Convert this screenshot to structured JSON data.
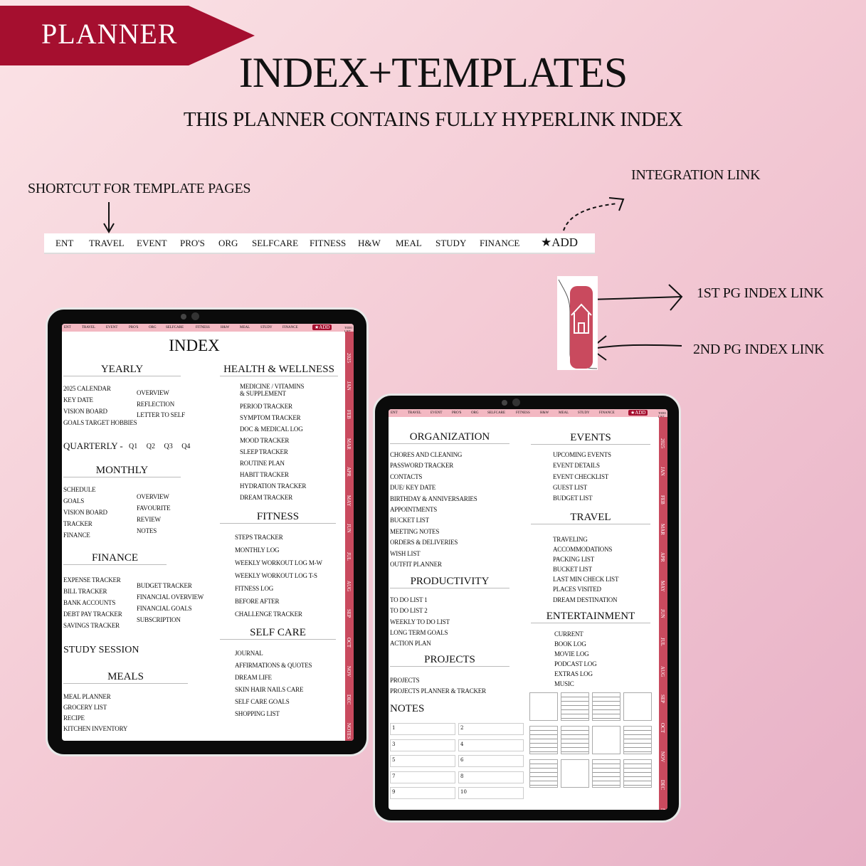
{
  "banner": "PLANNER",
  "title": "INDEX+TEMPLATES",
  "subtitle": "THIS PLANNER CONTAINS FULLY HYPERLINK INDEX",
  "annotations": {
    "shortcut": "SHORTCUT FOR TEMPLATE PAGES",
    "integration": "INTEGRATION LINK",
    "first_pg": "1ST PG INDEX LINK",
    "second_pg": "2ND PG INDEX LINK"
  },
  "tabs": [
    "ENT",
    "TRAVEL",
    "EVENT",
    "PRO'S",
    "ORG",
    "SELFCARE",
    "FITNESS",
    "H&W",
    "MEAL",
    "STUDY",
    "FINANCE"
  ],
  "add_label": "★ADD",
  "todo_label": "TODO LIST",
  "months": [
    "2025",
    "JAN",
    "FEB",
    "MAR",
    "APR",
    "MAY",
    "JUN",
    "JUL",
    "AUG",
    "SEP",
    "OCT",
    "NOV",
    "DEC",
    "NOTES"
  ],
  "colors": {
    "accent": "#a50f2f",
    "tab_pink": "#f3b8c2",
    "side_tab": "#c94a5e"
  },
  "page1": {
    "title": "INDEX",
    "yearly": {
      "heading": "YEARLY",
      "left": [
        "2025 CALENDAR",
        "KEY DATE",
        "VISION BOARD",
        "GOALS TARGET HOBBIES"
      ],
      "right": [
        "OVERVIEW",
        "REFLECTION",
        "LETTER TO SELF"
      ]
    },
    "quarterly": {
      "label": "QUARTERLY -",
      "items": [
        "Q1",
        "Q2",
        "Q3",
        "Q4"
      ]
    },
    "monthly": {
      "heading": "MONTHLY",
      "left": [
        "SCHEDULE",
        "GOALS",
        "VISION BOARD",
        "TRACKER",
        "FINANCE"
      ],
      "right": [
        "OVERVIEW",
        "FAVOURITE",
        "REVIEW",
        "NOTES"
      ]
    },
    "finance": {
      "heading": "FINANCE",
      "left": [
        "EXPENSE TRACKER",
        "BILL TRACKER",
        "BANK ACCOUNTS",
        "DEBT PAY TRACKER",
        "SAVINGS TRACKER"
      ],
      "right": [
        "BUDGET TRACKER",
        "FINANCIAL OVERVIEW",
        "FINANCIAL GOALS",
        "SUBSCRIPTION"
      ]
    },
    "study": "STUDY SESSION",
    "meals": {
      "heading": "MEALS",
      "items": [
        "MEAL PLANNER",
        "GROCERY LIST",
        "RECIPE",
        "KITCHEN INVENTORY"
      ]
    },
    "health": {
      "heading": "HEALTH  & WELLNESS",
      "items": [
        "MEDICINE / VITAMINS",
        "& SUPPLEMENT",
        "PERIOD TRACKER",
        "SYMPTOM TRACKER",
        "DOC & MEDICAL LOG",
        "MOOD TRACKER",
        "SLEEP TRACKER",
        "ROUTINE PLAN",
        "HABIT TRACKER",
        "HYDRATION TRACKER",
        "DREAM TRACKER"
      ]
    },
    "fitness": {
      "heading": "FITNESS",
      "items": [
        "STEPS TRACKER",
        "MONTHLY LOG",
        "WEEKLY WORKOUT LOG  M-W",
        "WEEKLY WORKOUT LOG T-S",
        "FITNESS LOG",
        "BEFORE AFTER",
        "CHALLENGE TRACKER"
      ]
    },
    "selfcare": {
      "heading": "SELF CARE",
      "items": [
        "JOURNAL",
        "AFFIRMATIONS & QUOTES",
        "DREAM LIFE",
        "SKIN HAIR NAILS CARE",
        "SELF CARE GOALS",
        "SHOPPING LIST"
      ]
    }
  },
  "page2": {
    "organization": {
      "heading": "ORGANIZATION",
      "items": [
        "CHORES AND CLEANING",
        "PASSWORD TRACKER",
        "CONTACTS",
        "DUE/ KEY DATE",
        "BIRTHDAY & ANNIVERSARIES",
        "APPOINTMENTS",
        "BUCKET LIST",
        "MEETING NOTES",
        "ORDERS & DELIVERIES",
        "WISH LIST",
        "OUTFIT PLANNER"
      ]
    },
    "productivity": {
      "heading": "PRODUCTIVITY",
      "items": [
        "TO DO LIST 1",
        "TO DO LIST 2",
        "WEEKLY TO DO LIST",
        "LONG TERM GOALS",
        "ACTION PLAN"
      ]
    },
    "projects": {
      "heading": "PROJECTS",
      "items": [
        "PROJECTS",
        "PROJECTS PLANNER & TRACKER"
      ]
    },
    "notes": {
      "heading": "NOTES",
      "numbers": [
        "1",
        "2",
        "3",
        "4",
        "5",
        "6",
        "7",
        "8",
        "9",
        "10"
      ]
    },
    "events": {
      "heading": "EVENTS",
      "items": [
        "UPCOMING EVENTS",
        "EVENT DETAILS",
        "EVENT CHECKLIST",
        "GUEST LIST",
        "BUDGET LIST"
      ]
    },
    "travel": {
      "heading": "TRAVEL",
      "items": [
        "TRAVELING",
        "ACCOMMODATIONS",
        "PACKING LIST",
        "BUCKET LIST",
        "LAST MIN CHECK LIST",
        "PLACES VISITED",
        "DREAM DESTINATION"
      ]
    },
    "entertainment": {
      "heading": "ENTERTAINMENT",
      "items": [
        "CURRENT",
        "BOOK LOG",
        "MOVIE LOG",
        "PODCAST LOG",
        "EXTRAS LOG",
        "MUSIC"
      ]
    }
  }
}
